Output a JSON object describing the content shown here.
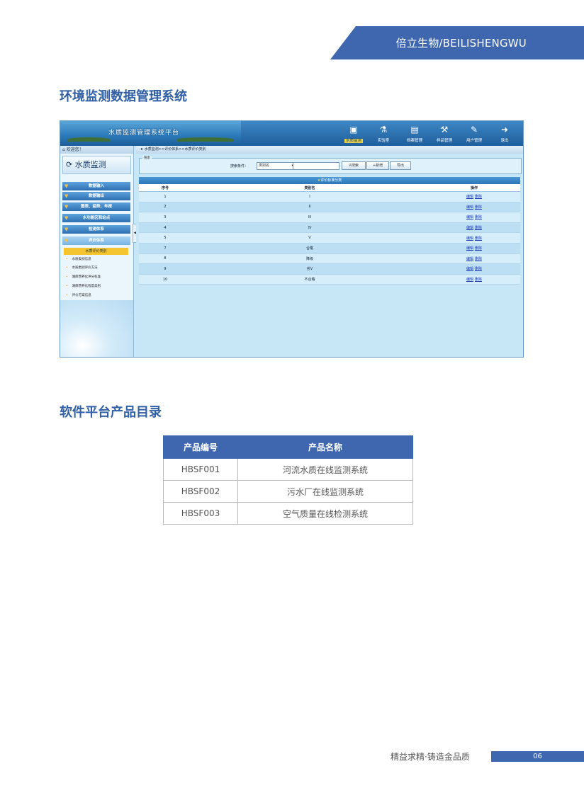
{
  "header": {
    "brand": "倍立生物/BEILISHENGWU",
    "brand_color": "#3e67b0"
  },
  "section1": {
    "title": "环境监测数据管理系统"
  },
  "screenshot": {
    "app_title": "水质监测管理系统平台",
    "app_subtitle": "",
    "nav": [
      {
        "label": "水质监测",
        "icon": "monitor-icon",
        "active": true
      },
      {
        "label": "实验室",
        "icon": "lab-icon"
      },
      {
        "label": "档案管理",
        "icon": "archive-icon"
      },
      {
        "label": "样品管理",
        "icon": "sample-icon"
      },
      {
        "label": "用户管理",
        "icon": "user-icon"
      },
      {
        "label": "退出",
        "icon": "exit-icon"
      }
    ],
    "welcome": "欢迎您！",
    "panel_title": "水质监测",
    "menu": [
      "数据输入",
      "数据输出",
      "图表、趋势、年报",
      "水功能区和站点",
      "检测体系",
      "评价体系"
    ],
    "submenu_active": "水质评价类别",
    "submenu": [
      "水质类别信息",
      "水质类别评价方法",
      "湖库营养化评分标准",
      "湖库营养化程度类别",
      "评价方案信息"
    ],
    "breadcrumb": "水质监测>>评价体系>>水质评价类别",
    "search": {
      "legend": "搜索",
      "label": "搜索条件：",
      "select_value": "类别名",
      "btn_search": "搜索",
      "btn_add": "新增",
      "btn_export": "导出"
    },
    "table": {
      "caption": "评价标准分类",
      "headers": [
        "序号",
        "类别名",
        "操作"
      ],
      "rows": [
        [
          "1",
          "I"
        ],
        [
          "2",
          "II"
        ],
        [
          "3",
          "III"
        ],
        [
          "4",
          "IV"
        ],
        [
          "5",
          "V"
        ],
        [
          "7",
          "合格"
        ],
        [
          "8",
          "降级"
        ],
        [
          "9",
          "劣V"
        ],
        [
          "10",
          "不合格"
        ]
      ],
      "action_edit": "编辑",
      "action_delete": "删除"
    }
  },
  "section2": {
    "title": "软件平台产品目录"
  },
  "products": {
    "headers": [
      "产品编号",
      "产品名称"
    ],
    "rows": [
      [
        "HBSF001",
        "河流水质在线监测系统"
      ],
      [
        "HBSF002",
        "污水厂在线监测系统"
      ],
      [
        "HBSF003",
        "空气质量在线检测系统"
      ]
    ]
  },
  "footer": {
    "slogan": "精益求精·铸造金品质",
    "page": "06"
  }
}
